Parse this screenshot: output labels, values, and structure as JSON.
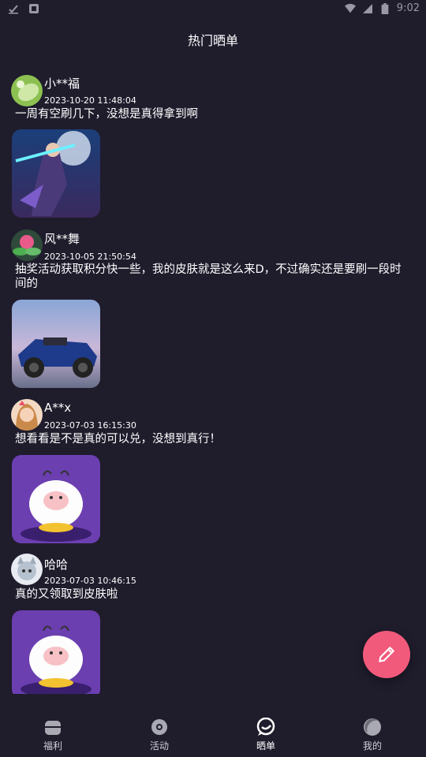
{
  "status_bar": {
    "time": "9:02"
  },
  "header": {
    "title": "热门晒单"
  },
  "posts": [
    {
      "user": "小**福",
      "time": "2023-10-20 11:48:04",
      "text": "一周有空刷几下，没想是真得拿到啊"
    },
    {
      "user": "风**舞",
      "time": "2023-10-05 21:50:54",
      "text": "抽奖活动获取积分快一些，我的皮肤就是这么来D，不过确实还是要刷一段时间的"
    },
    {
      "user": "A**x",
      "time": "2023-07-03 16:15:30",
      "text": "想看看是不是真的可以兑，没想到真行！"
    },
    {
      "user": "哈哈",
      "time": "2023-07-03 10:46:15",
      "text": "真的又领取到皮肤啦"
    }
  ],
  "tabs": [
    {
      "label": "福利",
      "icon": "gift-icon"
    },
    {
      "label": "活动",
      "icon": "activity-icon"
    },
    {
      "label": "晒单",
      "icon": "chat-bubble-icon"
    },
    {
      "label": "我的",
      "icon": "profile-icon"
    }
  ],
  "colors": {
    "background": "#1f1c2c",
    "fab": "#f25a7c"
  }
}
